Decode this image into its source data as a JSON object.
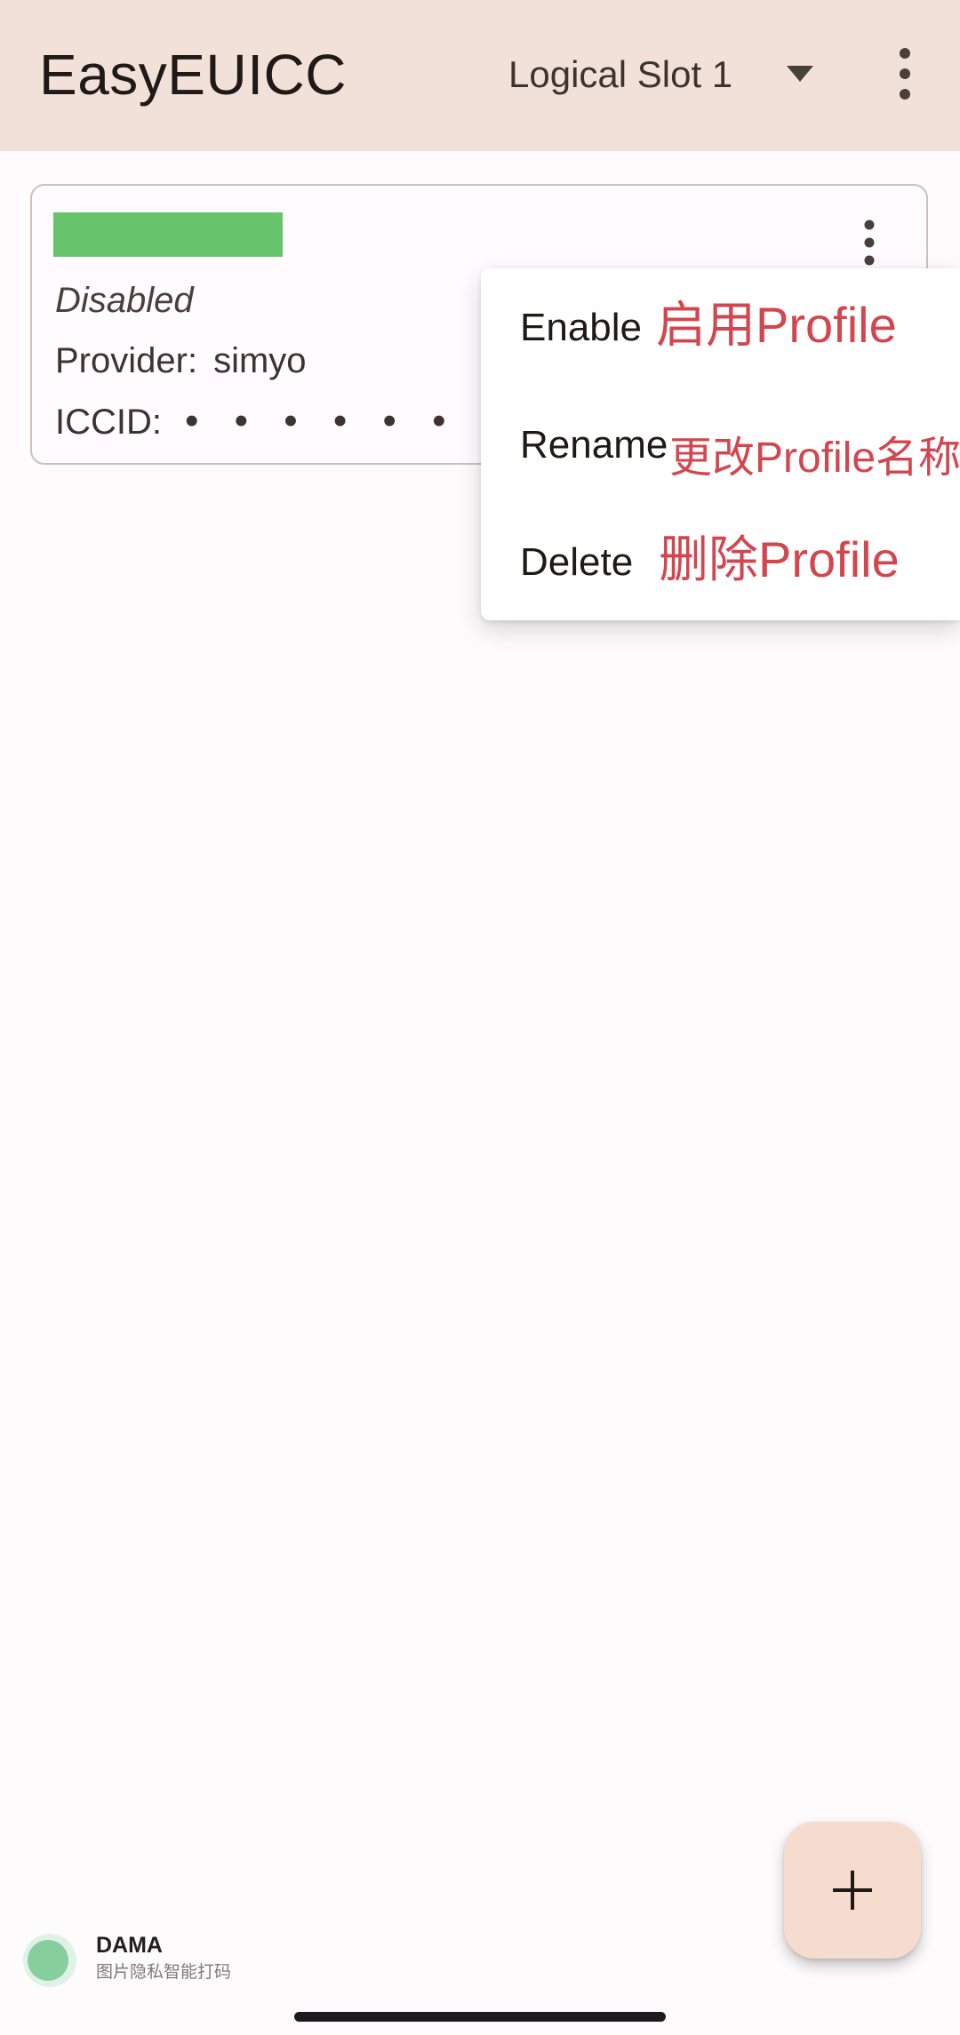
{
  "app_bar": {
    "title": "EasyEUICC",
    "slot_selector": {
      "selected": "Logical Slot 1",
      "icon": "dropdown-arrow-icon"
    },
    "overflow_icon": "more-vert-icon"
  },
  "profile_card": {
    "status": "Disabled",
    "provider_label": "Provider:",
    "provider_value": "simyo",
    "iccid_label": "ICCID:",
    "iccid_value": "• • • • • • • • •",
    "menu_icon": "more-vert-icon",
    "name_redaction_color": "#67c46a"
  },
  "popup_menu": {
    "items": [
      {
        "label": "Enable",
        "note": "启用Profile"
      },
      {
        "label": "Rename",
        "note": "更改Profile名称"
      },
      {
        "label": "Delete",
        "note": "删除Profile"
      }
    ],
    "note_color": "#d2474f"
  },
  "fab": {
    "icon": "add-icon"
  },
  "watermark": {
    "title": "DAMA",
    "subtitle": "图片隐私智能打码"
  },
  "colors": {
    "app_bar": "#f2e1d8",
    "background": "#fefbfd",
    "fab": "#f6dccf"
  }
}
